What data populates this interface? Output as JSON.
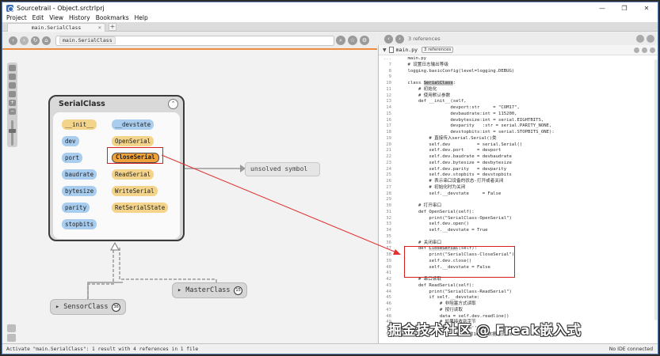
{
  "window": {
    "title": "Sourcetrail - Object.srctrlprj",
    "controls": [
      "—",
      "❐",
      "✕"
    ]
  },
  "menu": [
    "Project",
    "Edit",
    "View",
    "History",
    "Bookmarks",
    "Help"
  ],
  "tab": {
    "label": "main.SerialClass",
    "close": "×",
    "add": "+"
  },
  "toolbar": {
    "back": "‹",
    "forward": "›",
    "refresh": "↻",
    "home": "⌂",
    "search_token": "main.SerialClass",
    "search_icon": "⌕",
    "star_icon": "☆",
    "gear_icon": "⚙"
  },
  "code_toolbar": {
    "ref_count": "3 references"
  },
  "graph": {
    "class_name": "SerialClass",
    "collapse_glyph": "⌃",
    "members_left": [
      "__init__",
      "dev",
      "port",
      "baudrate",
      "bytesize",
      "parity",
      "stopbits"
    ],
    "members_right": [
      "__devstate",
      "OpenSerial",
      "CloseSerial",
      "ReadSerial",
      "WriteSerial",
      "RetSerialState"
    ],
    "unsolved": "unsolved symbol",
    "master": {
      "name": "MasterClass",
      "count": "15"
    },
    "sensor": {
      "name": "SensorClass",
      "count": "36"
    },
    "zoom_plus": "+",
    "zoom_minus": "−"
  },
  "code": {
    "file_name": "main.py",
    "file_refs": "3 references",
    "lines": [
      {
        "n": "...",
        "t": "    main.py"
      },
      {
        "n": "7",
        "t": "    # 设置日志输出等级"
      },
      {
        "n": "8",
        "t": "    logging.basicConfig(level=logging.DEBUG)"
      },
      {
        "n": "9",
        "t": ""
      },
      {
        "n": "10",
        "t": "    class ",
        "h": "SerialClass",
        "r": ":"
      },
      {
        "n": "11",
        "t": "        # 初始化"
      },
      {
        "n": "12",
        "t": "        # 使用默认参数"
      },
      {
        "n": "13",
        "t": "        def __init__(self,"
      },
      {
        "n": "14",
        "t": "                    devport:str     = \"COM17\","
      },
      {
        "n": "15",
        "t": "                    devbaudrate:int = 115200,"
      },
      {
        "n": "16",
        "t": "                    devbytesize:int = serial.EIGHTBITS,"
      },
      {
        "n": "17",
        "t": "                    devparity   :str = serial.PARITY_NONE,"
      },
      {
        "n": "18",
        "t": "                    devstopbits:int = serial.STOPBITS_ONE):"
      },
      {
        "n": "19",
        "t": "            # 直接传入serial.Serial()类"
      },
      {
        "n": "20",
        "t": "            self.dev          = serial.Serial()"
      },
      {
        "n": "21",
        "t": "            self.dev.port     = devport"
      },
      {
        "n": "22",
        "t": "            self.dev.baudrate = devbaudrate"
      },
      {
        "n": "23",
        "t": "            self.dev.bytesize = devbytesize"
      },
      {
        "n": "24",
        "t": "            self.dev.parity   = devparity"
      },
      {
        "n": "25",
        "t": "            self.dev.stopbits = devstopbits"
      },
      {
        "n": "26",
        "t": "            # 表示串口设备的状态-打开或者关闭"
      },
      {
        "n": "27",
        "t": "            # 初始化时为关闭"
      },
      {
        "n": "28",
        "t": "            self.__devstate     = False"
      },
      {
        "n": "29",
        "t": ""
      },
      {
        "n": "30",
        "t": "        # 打开串口"
      },
      {
        "n": "31",
        "t": "        def OpenSerial(self):"
      },
      {
        "n": "32",
        "t": "            print(\"SerialClass-OpenSerial\")"
      },
      {
        "n": "33",
        "t": "            self.dev.open()"
      },
      {
        "n": "34",
        "t": "            self.__devstate = True"
      },
      {
        "n": "35",
        "t": ""
      },
      {
        "n": "36",
        "t": "        # 关闭串口"
      },
      {
        "n": "37",
        "t": "        def ",
        "h2": "CloseSerial",
        "r": "(self):"
      },
      {
        "n": "38",
        "t": "            print(\"SerialClass-CloseSerial\")"
      },
      {
        "n": "39",
        "t": "            self.dev.close()"
      },
      {
        "n": "40",
        "t": "            self.__devstate = False"
      },
      {
        "n": "41",
        "t": ""
      },
      {
        "n": "42",
        "t": "        # 串口读取"
      },
      {
        "n": "43",
        "t": "        def ReadSerial(self):"
      },
      {
        "n": "44",
        "t": "            print(\"SerialClass-ReadSerial\")"
      },
      {
        "n": "45",
        "t": "            if self.__devstate:"
      },
      {
        "n": "46",
        "t": "                # 非阻塞方式读取"
      },
      {
        "n": "47",
        "t": "                # 按行读取"
      },
      {
        "n": "48",
        "t": "                data = self.dev.readline()"
      },
      {
        "n": "49",
        "t": "                # 如果接收到字节"
      },
      {
        "n": "50",
        "t": "                if data != b'':"
      },
      {
        "n": "51",
        "t": "                    # 将接受的16进制数据格式如b'h"
      }
    ]
  },
  "status": {
    "left": "Activate \"main.SerialClass\": 1 result with 4 references in 1 file",
    "right": "No IDE connected"
  },
  "watermark": "掘金技术社区 @ Freak嵌入式"
}
